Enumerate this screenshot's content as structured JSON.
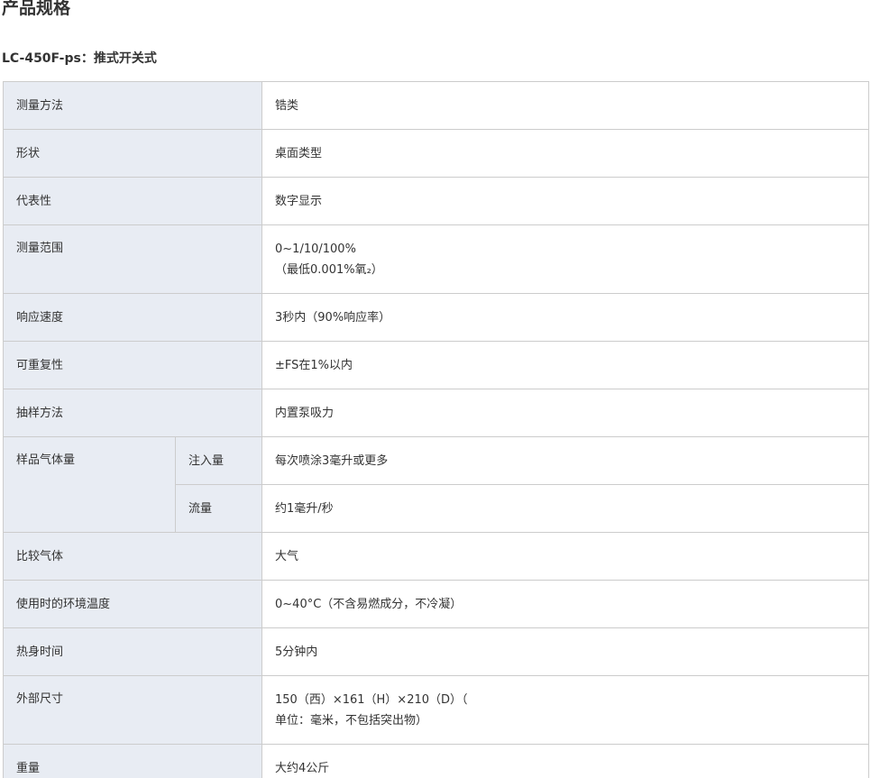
{
  "page_title": "产品规格",
  "model_title": "LC-450F-ps：推式开关式",
  "rows": [
    {
      "label": "测量方法",
      "value": "锆类"
    },
    {
      "label": "形状",
      "value": "桌面类型"
    },
    {
      "label": "代表性",
      "value": "数字显示"
    },
    {
      "label": "测量范围",
      "value_lines": [
        "0~1/10/100%",
        "（最低0.001%氧₂）"
      ]
    },
    {
      "label": "响应速度",
      "value": "3秒内（90%响应率）"
    },
    {
      "label": "可重复性",
      "value": "±FS在1%以内"
    },
    {
      "label": "抽样方法",
      "value": "内置泵吸力"
    },
    {
      "label": "样品气体量",
      "sub": [
        {
          "label": "注入量",
          "value": "每次喷涂3毫升或更多"
        },
        {
          "label": "流量",
          "value": "约1毫升/秒"
        }
      ]
    },
    {
      "label": "比较气体",
      "value": "大气"
    },
    {
      "label": "使用时的环境温度",
      "value": "0~40°C（不含易燃成分，不冷凝）"
    },
    {
      "label": "热身时间",
      "value": "5分钟内"
    },
    {
      "label": "外部尺寸",
      "value_lines": [
        "150（西）×161（H）×210（D）（",
        "单位：毫米，不包括突出物）"
      ]
    },
    {
      "label": "重量",
      "value": "大约4公斤"
    }
  ]
}
